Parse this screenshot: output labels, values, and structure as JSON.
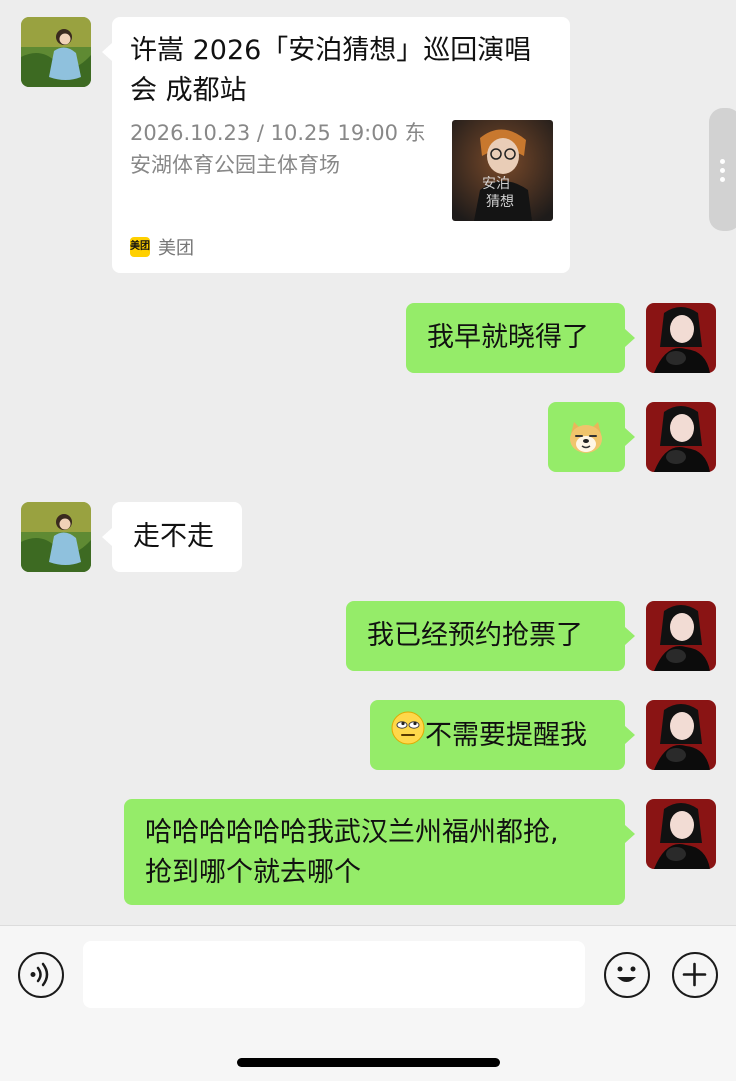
{
  "card": {
    "title": "许嵩 2026「安泊猜想」巡回演唱会 成都站",
    "subtitle": "2026.10.23 / 10.25 19:00 东安湖体育公园主体育场",
    "thumb_text": "安泊猜想",
    "source_logo": "美团",
    "source_name": "美团"
  },
  "messages": {
    "m1": "我早就晓得了",
    "m2_emoji": "doge-emoji",
    "m3": "走不走",
    "m4": "我已经预约抢票了",
    "m5": "不需要提醒我",
    "m6_line1": "哈哈哈哈哈哈我武汉兰州福州都抢,",
    "m6_line2": "抢到哪个就去哪个"
  },
  "colors": {
    "background": "#ededed",
    "sent_bubble": "#95ec69",
    "received_bubble": "#ffffff",
    "input_bar": "#f6f6f6"
  },
  "icons": {
    "voice": "voice-icon",
    "emoji": "emoji-icon",
    "plus": "plus-icon"
  }
}
